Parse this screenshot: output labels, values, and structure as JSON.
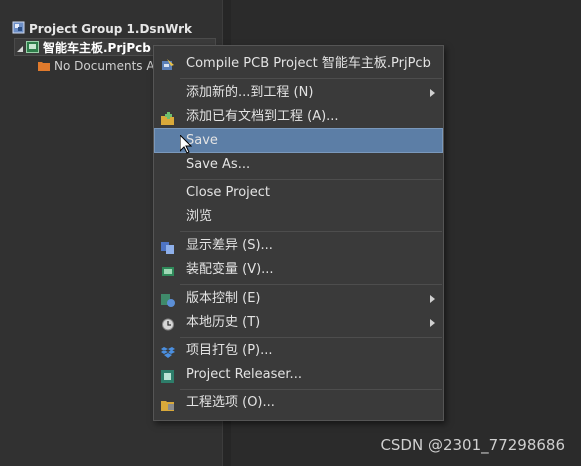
{
  "tree": {
    "group_label": "Project Group 1.DsnWrk",
    "project_label": "智能车主板.PrjPcb",
    "nodocs_label": "No Documents Add"
  },
  "menu": {
    "items": [
      {
        "label": "Compile PCB Project 智能车主板.PrjPcb",
        "icon": "compile-icon"
      },
      {
        "label": "添加新的...到工程 (N)",
        "submenu": true
      },
      {
        "label": "添加已有文档到工程 (A)...",
        "icon": "add-existing-icon"
      },
      {
        "label": "Save",
        "highlighted": true
      },
      {
        "label": "Save As..."
      },
      {
        "label": "Close Project"
      },
      {
        "label": "浏览"
      },
      {
        "label": "显示差异 (S)...",
        "icon": "diff-icon"
      },
      {
        "label": "装配变量 (V)...",
        "icon": "variants-icon"
      },
      {
        "label": "版本控制 (E)",
        "icon": "version-control-icon",
        "submenu": true
      },
      {
        "label": "本地历史 (T)",
        "icon": "history-icon",
        "submenu": true
      },
      {
        "label": "项目打包 (P)...",
        "icon": "package-icon"
      },
      {
        "label": "Project Releaser...",
        "icon": "releaser-icon"
      },
      {
        "label": "工程选项 (O)...",
        "icon": "options-icon"
      }
    ]
  },
  "watermark": "CSDN @2301_77298686",
  "colors": {
    "menu_bg": "#3a3a3a",
    "highlight": "#5c7ea6",
    "panel_bg": "#313131"
  }
}
